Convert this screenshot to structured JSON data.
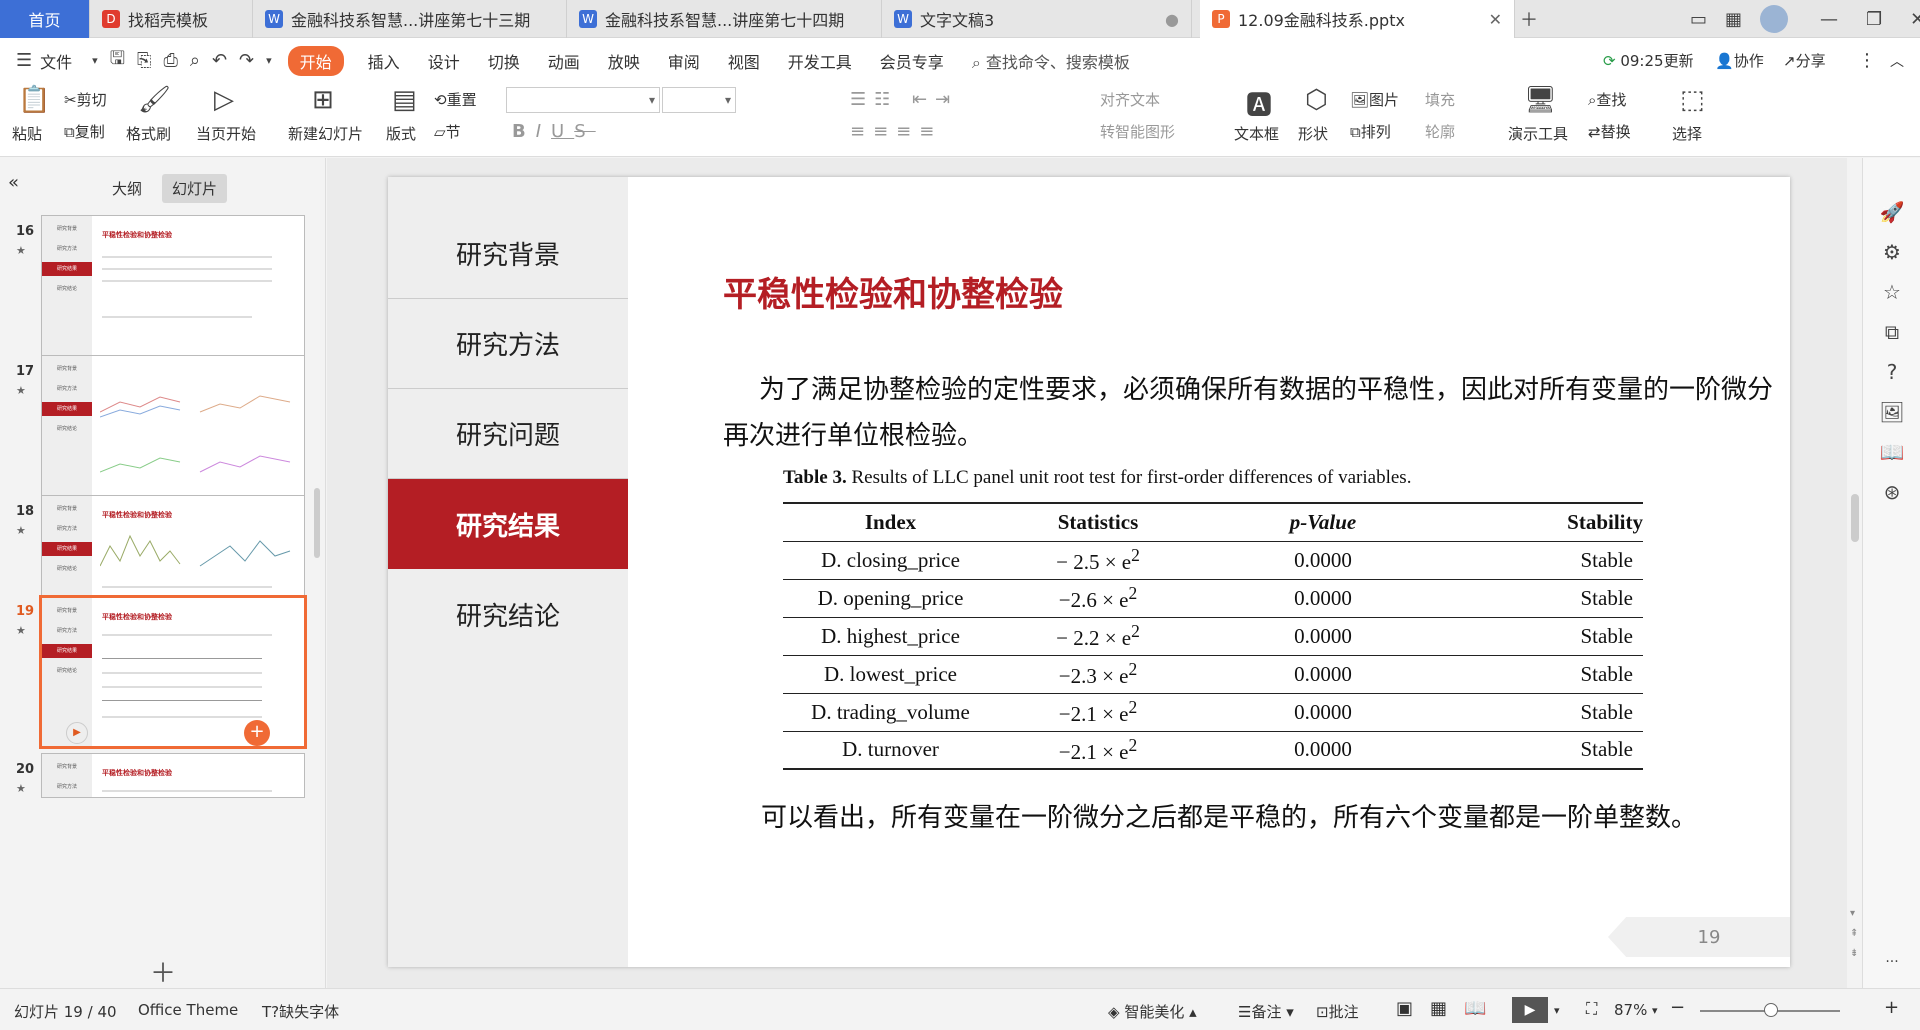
{
  "tabs": {
    "home": "首页",
    "t1": "找稻壳模板",
    "t2": "金融科技系智慧...讲座第七十三期",
    "t3": "金融科技系智慧...讲座第七十四期",
    "t4": "文字文稿3",
    "t5": "12.09金融科技系.pptx"
  },
  "menu": {
    "file": "文件",
    "start": "开始",
    "insert": "插入",
    "design": "设计",
    "transition": "切换",
    "animation": "动画",
    "slideshow": "放映",
    "review": "审阅",
    "view": "视图",
    "devtools": "开发工具",
    "member": "会员专享",
    "search": "查找命令、搜索模板",
    "updated": "09:25更新",
    "collab": "协作",
    "share": "分享"
  },
  "ribbon": {
    "paste": "粘贴",
    "cut": "剪切",
    "copy": "复制",
    "format_painter": "格式刷",
    "from_current": "当页开始",
    "new_slide": "新建幻灯片",
    "layout": "版式",
    "section": "节",
    "reset": "重置",
    "align_text": "对齐文本",
    "convert_smartart": "转智能图形",
    "textbox": "文本框",
    "shape": "形状",
    "arrange": "排列",
    "picture": "图片",
    "fill": "填充",
    "outline": "轮廓",
    "present_tools": "演示工具",
    "find": "查找",
    "replace": "替换",
    "select": "选择"
  },
  "sidebar": {
    "outline_tab": "大纲",
    "slides_tab": "幻灯片",
    "thumbs": [
      {
        "num": "16",
        "title": "平稳性检验和协整检验"
      },
      {
        "num": "17",
        "title": ""
      },
      {
        "num": "18",
        "title": "平稳性检验和协整检验"
      },
      {
        "num": "19",
        "title": "平稳性检验和协整检验"
      },
      {
        "num": "20",
        "title": "平稳性检验和协整检验"
      }
    ],
    "nav_mini": [
      "研究背景",
      "研究方法",
      "研究结果",
      "研究结论"
    ]
  },
  "slide": {
    "nav": [
      "研究背景",
      "研究方法",
      "研究问题",
      "研究结果",
      "研究结论"
    ],
    "title": "平稳性检验和协整检验",
    "para": "为了满足协整检验的定性要求，必须确保所有数据的平稳性，因此对所有变量的一阶微分再次进行单位根检验。",
    "caption_label": "Table 3.",
    "caption_text": "Results of LLC panel unit root test for first-order differences of variables.",
    "table": {
      "headers": [
        "Index",
        "Statistics",
        "p-Value",
        "Stability"
      ],
      "rows": [
        [
          "D. closing_price",
          "− 2.5 × e",
          "0.0000",
          "Stable"
        ],
        [
          "D. opening_price",
          "−2.6 × e",
          "0.0000",
          "Stable"
        ],
        [
          "D. highest_price",
          "− 2.2 × e",
          "0.0000",
          "Stable"
        ],
        [
          "D. lowest_price",
          "−2.3 × e",
          "0.0000",
          "Stable"
        ],
        [
          "D. trading_volume",
          "−2.1 × e",
          "0.0000",
          "Stable"
        ],
        [
          "D. turnover",
          "−2.1 × e",
          "0.0000",
          "Stable"
        ]
      ],
      "exponent": "2"
    },
    "conclusion": "可以看出，所有变量在一阶微分之后都是平稳的，所有六个变量都是一阶单整数。",
    "page_number": "19"
  },
  "status": {
    "slide_count": "幻灯片 19 / 40",
    "theme": "Office Theme",
    "missing_font": "缺失字体",
    "beautify": "智能美化",
    "notes": "备注",
    "comments": "批注",
    "zoom": "87%"
  },
  "colors": {
    "accent": "#b41e24",
    "wps_orange": "#f06a35"
  }
}
